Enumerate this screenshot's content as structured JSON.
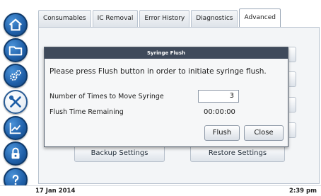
{
  "nav": {
    "items": [
      {
        "icon": "home-icon"
      },
      {
        "icon": "folder-icon"
      },
      {
        "icon": "gears-icon"
      },
      {
        "icon": "tools-icon"
      },
      {
        "icon": "chart-icon"
      },
      {
        "icon": "lock-icon"
      },
      {
        "icon": "help-icon"
      }
    ]
  },
  "tabs": [
    {
      "label": "Consumables"
    },
    {
      "label": "IC Removal"
    },
    {
      "label": "Error History"
    },
    {
      "label": "Diagnostics"
    },
    {
      "label": "Advanced",
      "active": true
    }
  ],
  "page": {
    "backup_label": "Backup Settings",
    "restore_label": "Restore Settings"
  },
  "dialog": {
    "title": "Syringe Flush",
    "message": "Please press Flush button in order to initiate syringe flush.",
    "times_label": "Number of Times to Move Syringe",
    "times_value": "3",
    "remaining_label": "Flush Time Remaining",
    "remaining_value": "00:00:00",
    "flush_label": "Flush",
    "close_label": "Close"
  },
  "status": {
    "date": "17 Jan 2014",
    "time": "2:39 pm"
  },
  "colors": {
    "nav_button": "#1f5fa8",
    "dialog_title_bar": "#3f4a5b"
  }
}
